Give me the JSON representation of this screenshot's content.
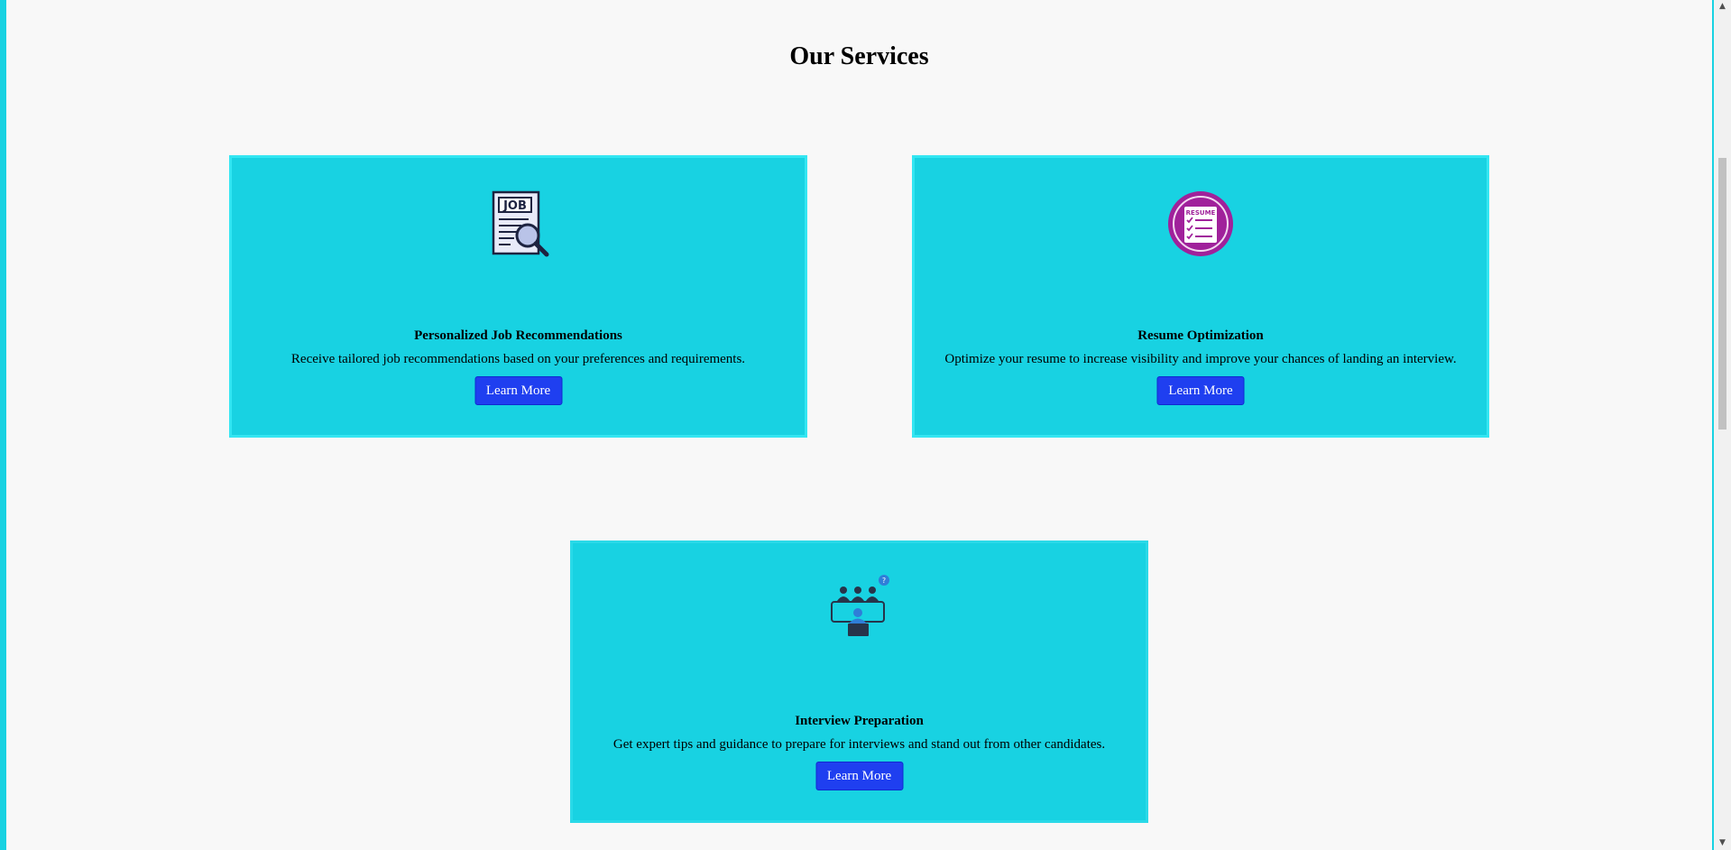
{
  "section": {
    "title": "Our Services"
  },
  "services": [
    {
      "title": "Personalized Job Recommendations",
      "description": "Receive tailored job recommendations based on your preferences and requirements.",
      "button_label": "Learn More",
      "icon": "job-search-icon",
      "icon_text": "JOB"
    },
    {
      "title": "Resume Optimization",
      "description": "Optimize your resume to increase visibility and improve your chances of landing an interview.",
      "button_label": "Learn More",
      "icon": "resume-checklist-icon",
      "icon_text": "RESUME"
    },
    {
      "title": "Interview Preparation",
      "description": "Get expert tips and guidance to prepare for interviews and stand out from other candidates.",
      "button_label": "Learn More",
      "icon": "interview-panel-icon",
      "icon_text": "?"
    }
  ],
  "colors": {
    "background": "#f8f8f8",
    "card": "#18d2e2",
    "button": "#1f3ff0",
    "resume_icon": "#a0219b"
  }
}
